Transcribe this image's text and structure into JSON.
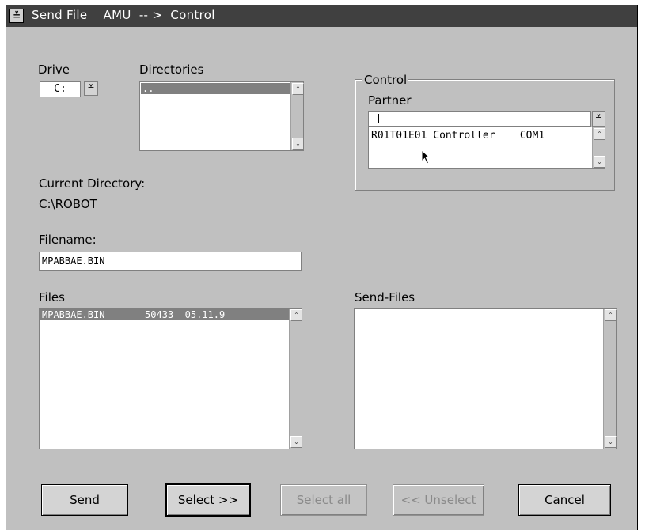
{
  "window": {
    "title": "Send File    AMU  -- >  Control",
    "sysmenu_glyph": "≚"
  },
  "drive": {
    "label": "Drive",
    "value": "C:",
    "dropdown_glyph": "≚"
  },
  "directories": {
    "label": "Directories",
    "items": [
      ".."
    ]
  },
  "current_directory": {
    "label": "Current Directory:",
    "value": "C:\\ROBOT"
  },
  "filename": {
    "label": "Filename:",
    "value": "MPABBAE.BIN"
  },
  "files": {
    "label": "Files",
    "items": [
      {
        "name": "MPABBAE.BIN",
        "size": "50433",
        "date": "05.11.9"
      }
    ],
    "first_row": "MPABBAE.BIN       50433  05.11.9"
  },
  "control": {
    "group_label": "Control",
    "partner_label": "Partner",
    "partner_value": "",
    "dropdown_glyph": "≚",
    "partners": [
      "R01T01E01 Controller    COM1"
    ]
  },
  "send_files": {
    "label": "Send-Files",
    "items": []
  },
  "buttons": {
    "send": "Send",
    "select": "Select >>",
    "select_all": "Select all",
    "unselect": "<< Unselect",
    "cancel": "Cancel"
  },
  "scroll_glyphs": {
    "up": "⌃",
    "down": "⌄"
  },
  "colors": {
    "background": "#c0c0c0",
    "titlebar": "#404040",
    "selection": "#808080"
  }
}
